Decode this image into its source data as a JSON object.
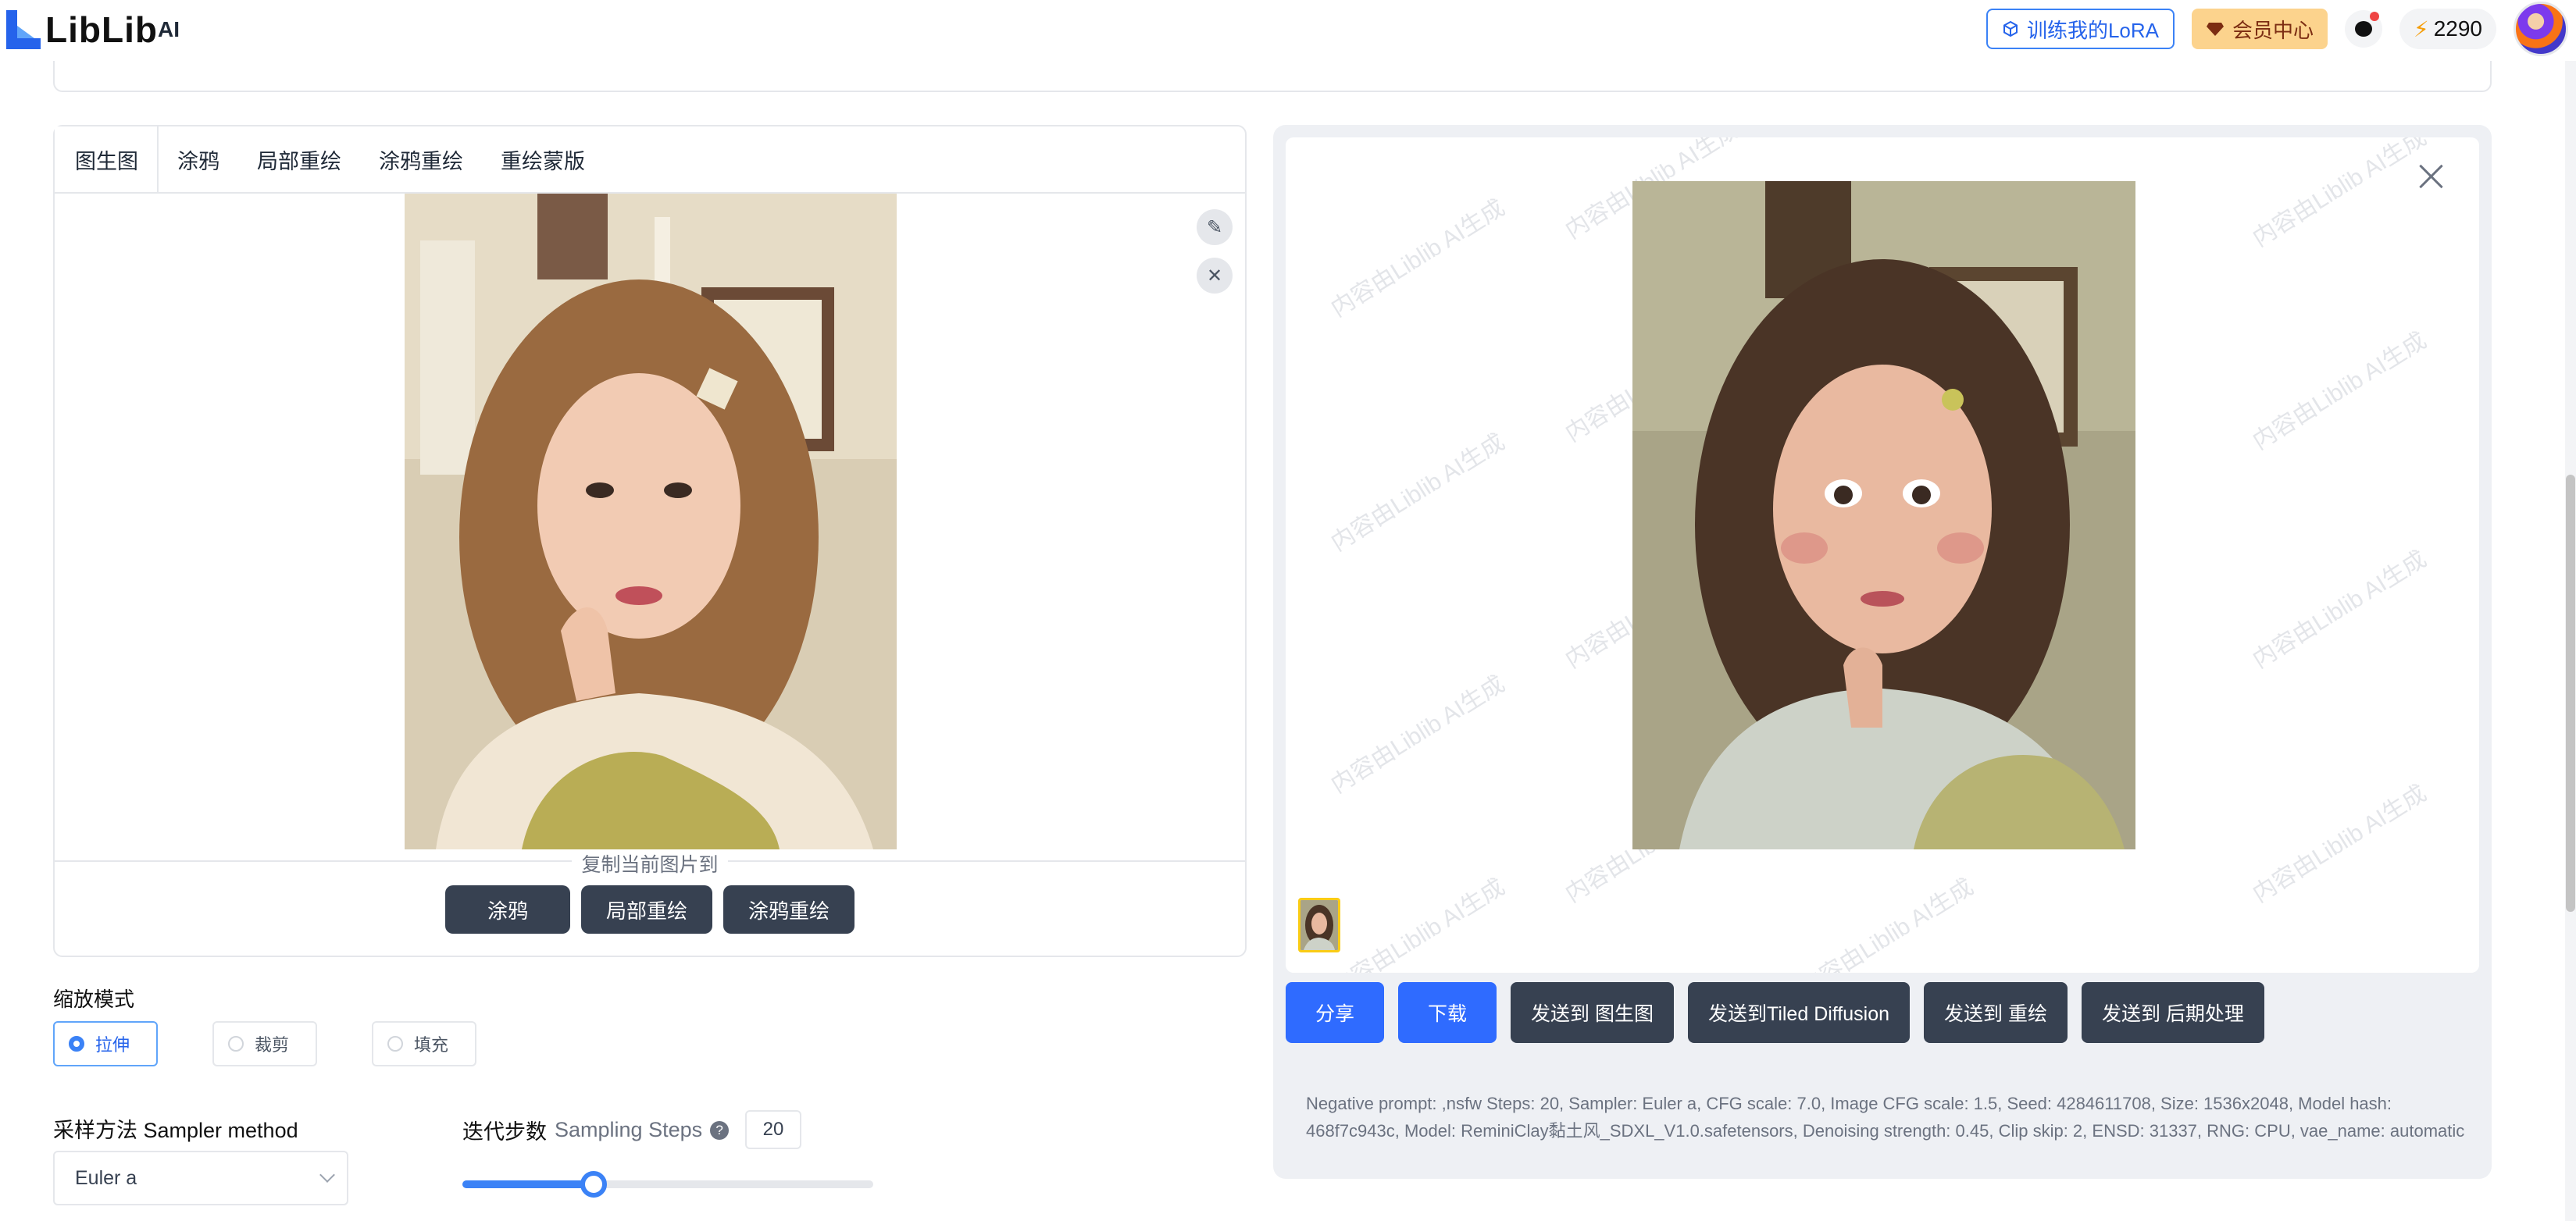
{
  "header": {
    "logo_text": "LibLib",
    "logo_ai": "AI",
    "train_lora_label": "训练我的LoRA",
    "member_center_label": "会员中心",
    "points": "2290"
  },
  "left_panel": {
    "tabs": [
      "图生图",
      "涂鸦",
      "局部重绘",
      "涂鸦重绘",
      "重绘蒙版"
    ],
    "copy_label": "复制当前图片到",
    "copy_buttons": [
      "涂鸦",
      "局部重绘",
      "涂鸦重绘"
    ]
  },
  "scale_mode": {
    "title": "缩放模式",
    "options": [
      "拉伸",
      "裁剪",
      "填充"
    ],
    "selected": "拉伸"
  },
  "sampler": {
    "title": "采样方法 Sampler method",
    "value": "Euler a"
  },
  "steps": {
    "title_cn": "迭代步数",
    "title_en": "Sampling Steps",
    "help": "?",
    "value": "20",
    "slider_fraction": 0.32
  },
  "result": {
    "watermark": "内容由Liblib AI生成",
    "actions": [
      "分享",
      "下载",
      "发送到 图生图",
      "发送到Tiled Diffusion",
      "发送到 重绘",
      "发送到 后期处理"
    ],
    "params_line1": "Negative prompt: ,nsfw Steps: 20, Sampler: Euler a, CFG scale: 7.0, Image CFG scale: 1.5, Seed: 4284611708, Size: 1536x2048, Model hash:",
    "params_line2": "468f7c943c, Model: ReminiClay黏土风_SDXL_V1.0.safetensors, Denoising strength: 0.45, Clip skip: 2, ENSD: 31337, RNG: CPU, vae_name: automatic"
  },
  "colors": {
    "accent_blue": "#2f6bff",
    "dark_button": "#374151",
    "member_gold": "#fcd38d"
  }
}
